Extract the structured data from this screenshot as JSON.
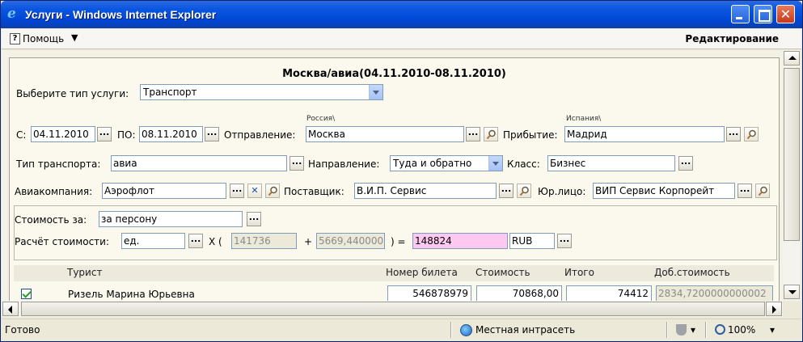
{
  "window": {
    "title": "Услуги - Windows Internet Explorer",
    "close_glyph": "✕"
  },
  "menubar": {
    "help_icon": "?",
    "help_label": "Помощь",
    "help_arrow": "▼",
    "edit_mode": "Редактирование"
  },
  "page": {
    "heading": "Москва/авиа(04.11.2010-08.11.2010)",
    "service_type_label": "Выберите тип услуги:",
    "service_type_value": "Транспорт",
    "dots": "...",
    "clear_glyph": "✕",
    "dates": {
      "from_label": "С:",
      "from_value": "04.11.2010",
      "to_label": "ПО:",
      "to_value": "08.11.2010"
    },
    "departure": {
      "label": "Отправление:",
      "country": "Россия\\",
      "value": "Москва"
    },
    "arrival": {
      "label": "Прибытие:",
      "country": "Испания\\",
      "value": "Мадрид"
    },
    "transport_type": {
      "label": "Тип транспорта:",
      "value": "авиа"
    },
    "direction": {
      "label": "Направление:",
      "value": "Туда и обратно"
    },
    "class": {
      "label": "Класс:",
      "value": "Бизнес"
    },
    "airline": {
      "label": "Авиакомпания:",
      "value": "Аэрофлот"
    },
    "supplier": {
      "label": "Поставщик:",
      "value": "В.И.П. Сервис"
    },
    "legal_entity": {
      "label": "Юр.лицо:",
      "value": "ВИП Сервис Корпорейт"
    },
    "cost_per": {
      "label": "Стоимость за:",
      "value": "за персону"
    },
    "calc": {
      "label": "Расчёт стоимости:",
      "unit": "ед.",
      "x_open": "X (",
      "base": "141736",
      "plus": "+",
      "extra": "5669,440000",
      "close_eq": ") =",
      "result": "148824",
      "currency": "RUB"
    },
    "table": {
      "headers": [
        "Турист",
        "Номер билета",
        "Стоимость",
        "Итого",
        "Доб.стоимость"
      ],
      "rows": [
        {
          "checked": true,
          "tourist": "Ризель Марина Юрьевна",
          "ticket": "546878979",
          "cost": "70868,00",
          "total": "74412",
          "extra_cost": "2834,7200000000002"
        }
      ]
    }
  },
  "statusbar": {
    "status": "Готово",
    "zone": "Местная интрасеть",
    "zoom": "100%",
    "dropdown_glyph": "▾"
  }
}
